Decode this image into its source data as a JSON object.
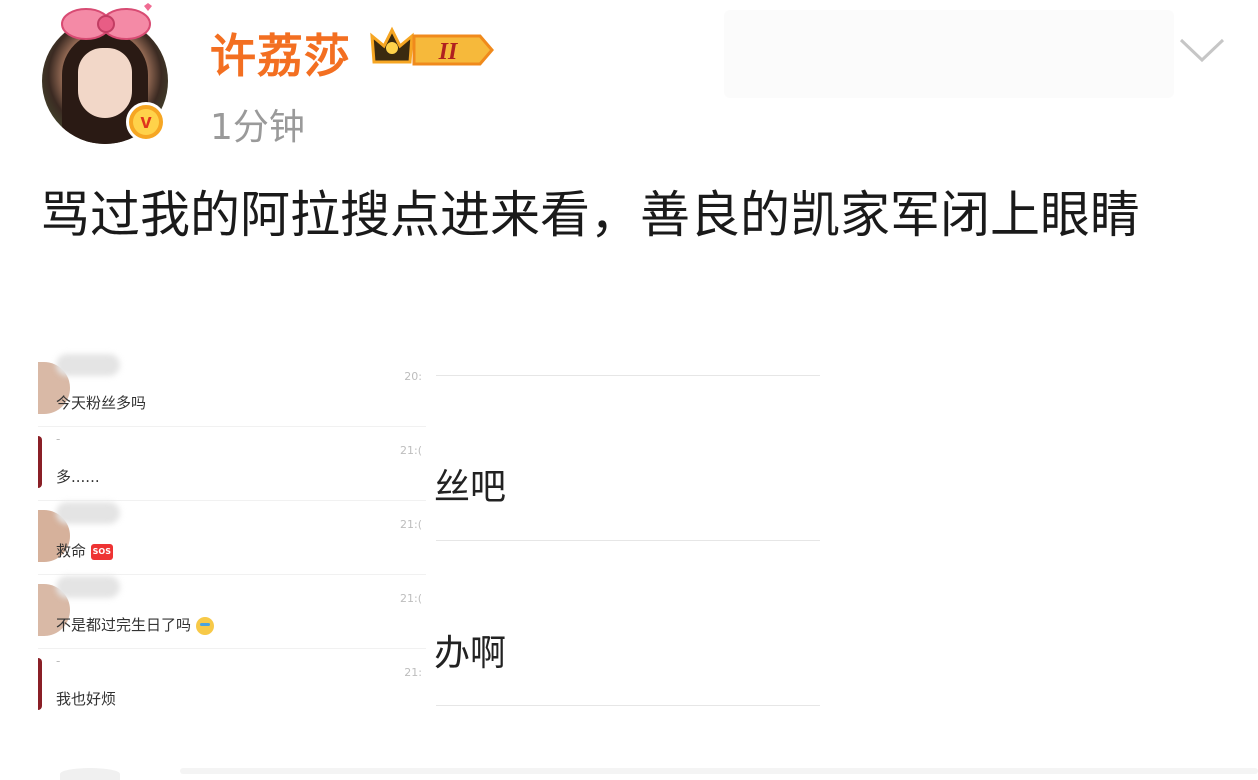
{
  "post": {
    "username": "许荔莎",
    "level_badge": "II",
    "timestamp": "1分钟",
    "text": "骂过我的阿拉搜点进来看，善良的凯家军闭上眼睛"
  },
  "colors": {
    "username": "#f36f21",
    "timestamp": "#9a9a9a",
    "badge_gold": "#f6a623"
  },
  "icons": {
    "verified": "verified-v-icon",
    "more": "chevron-down-icon",
    "level": "crown-level-icon"
  },
  "chat_image": {
    "rows": [
      {
        "message": "今天粉丝多吗",
        "time": "20:",
        "name_blurred": true,
        "avatar_color": "#d9b9a6"
      },
      {
        "message": "多......",
        "time": "21:(",
        "name_blurred": false,
        "avatar_color": "#8a1f26"
      },
      {
        "message": "救命",
        "time": "21:(",
        "name_blurred": true,
        "avatar_color": "#d6b19b",
        "emoji": "SOS"
      },
      {
        "message": "不是都过完生日了吗",
        "time": "21:(",
        "name_blurred": true,
        "avatar_color": "#d9b9a6",
        "emoji": "crying"
      },
      {
        "message": "我也好烦",
        "time": "21:",
        "name_blurred": false,
        "avatar_color": "#8a1f26"
      }
    ],
    "dash": "-"
  },
  "right_partials": {
    "line1": "丝吧",
    "line2": "办啊"
  }
}
